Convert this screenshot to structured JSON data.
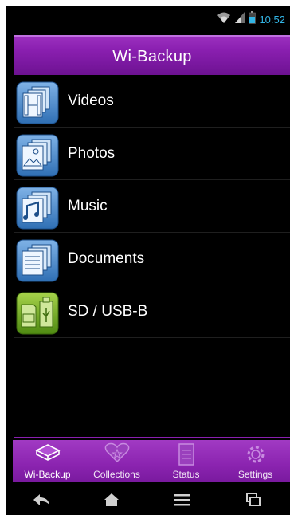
{
  "status_bar": {
    "time": "10:52",
    "icons": [
      "wifi-icon",
      "signal-icon",
      "battery-icon"
    ],
    "accent": "#33b5e5"
  },
  "header": {
    "title": "Wi-Backup"
  },
  "list": {
    "items": [
      {
        "label": "Videos",
        "icon": "video-icon"
      },
      {
        "label": "Photos",
        "icon": "photo-icon"
      },
      {
        "label": "Music",
        "icon": "music-icon"
      },
      {
        "label": "Documents",
        "icon": "document-icon"
      },
      {
        "label": "SD / USB-B",
        "icon": "sd-usb-icon"
      }
    ]
  },
  "tabs": [
    {
      "label": "Wi-Backup",
      "icon": "drive-icon",
      "active": true
    },
    {
      "label": "Collections",
      "icon": "heart-icon",
      "active": false
    },
    {
      "label": "Status",
      "icon": "status-icon",
      "active": false
    },
    {
      "label": "Settings",
      "icon": "gear-icon",
      "active": false
    }
  ],
  "nav": [
    "back-icon",
    "home-icon",
    "menu-icon",
    "recent-apps-icon"
  ],
  "colors": {
    "brand_purple": "#8a1fb0",
    "blue_tile": "#4d86c8",
    "green_tile": "#6ea81e"
  }
}
